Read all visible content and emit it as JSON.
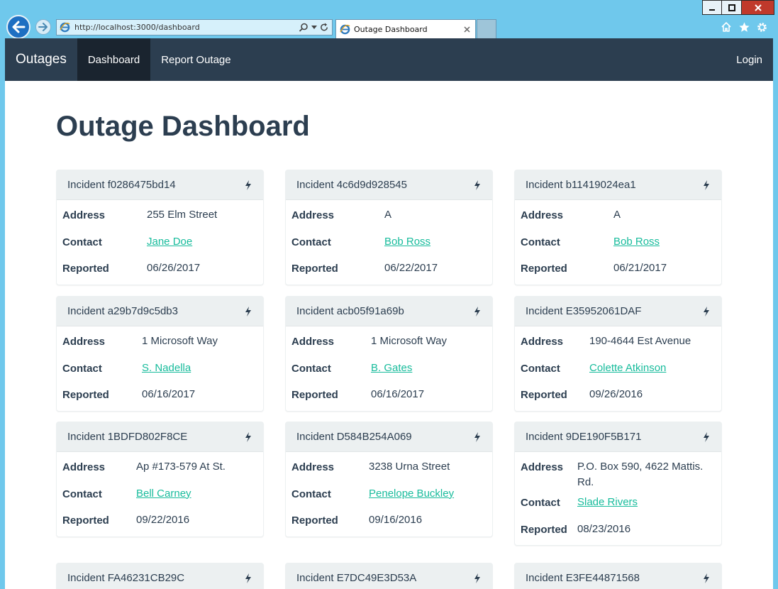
{
  "browser": {
    "url": "http://localhost:3000/dashboard",
    "tab_title": "Outage Dashboard"
  },
  "nav": {
    "brand": "Outages",
    "items": [
      {
        "label": "Dashboard",
        "active": true
      },
      {
        "label": "Report Outage",
        "active": false
      }
    ],
    "login": "Login"
  },
  "page": {
    "title": "Outage Dashboard"
  },
  "labels": {
    "address": "Address",
    "contact": "Contact",
    "reported": "Reported"
  },
  "incidents": [
    {
      "title": "Incident f0286475bd14",
      "address": "255 Elm Street",
      "contact": "Jane Doe",
      "reported": "06/26/2017"
    },
    {
      "title": "Incident 4c6d9d928545",
      "address": "A",
      "contact": "Bob Ross",
      "reported": "06/22/2017"
    },
    {
      "title": "Incident b11419024ea1",
      "address": "A",
      "contact": "Bob Ross",
      "reported": "06/21/2017"
    },
    {
      "title": "Incident a29b7d9c5db3",
      "address": "1 Microsoft Way",
      "contact": "S. Nadella",
      "reported": "06/16/2017"
    },
    {
      "title": "Incident acb05f91a69b",
      "address": "1 Microsoft Way",
      "contact": "B. Gates",
      "reported": "06/16/2017"
    },
    {
      "title": "Incident E35952061DAF",
      "address": "190-4644 Est Avenue",
      "contact": "Colette Atkinson",
      "reported": "09/26/2016"
    },
    {
      "title": "Incident 1BDFD802F8CE",
      "address": "Ap #173-579 At St.",
      "contact": "Bell Carney",
      "reported": "09/22/2016"
    },
    {
      "title": "Incident D584B254A069",
      "address": "3238 Urna Street",
      "contact": "Penelope Buckley",
      "reported": "09/16/2016"
    },
    {
      "title": "Incident 9DE190F5B171",
      "address": "P.O. Box 590, 4622 Mattis. Rd.",
      "contact": "Slade Rivers",
      "reported": "08/23/2016"
    },
    {
      "title": "Incident FA46231CB29C"
    },
    {
      "title": "Incident E7DC49E3D53A"
    },
    {
      "title": "Incident E3FE44871568"
    }
  ]
}
